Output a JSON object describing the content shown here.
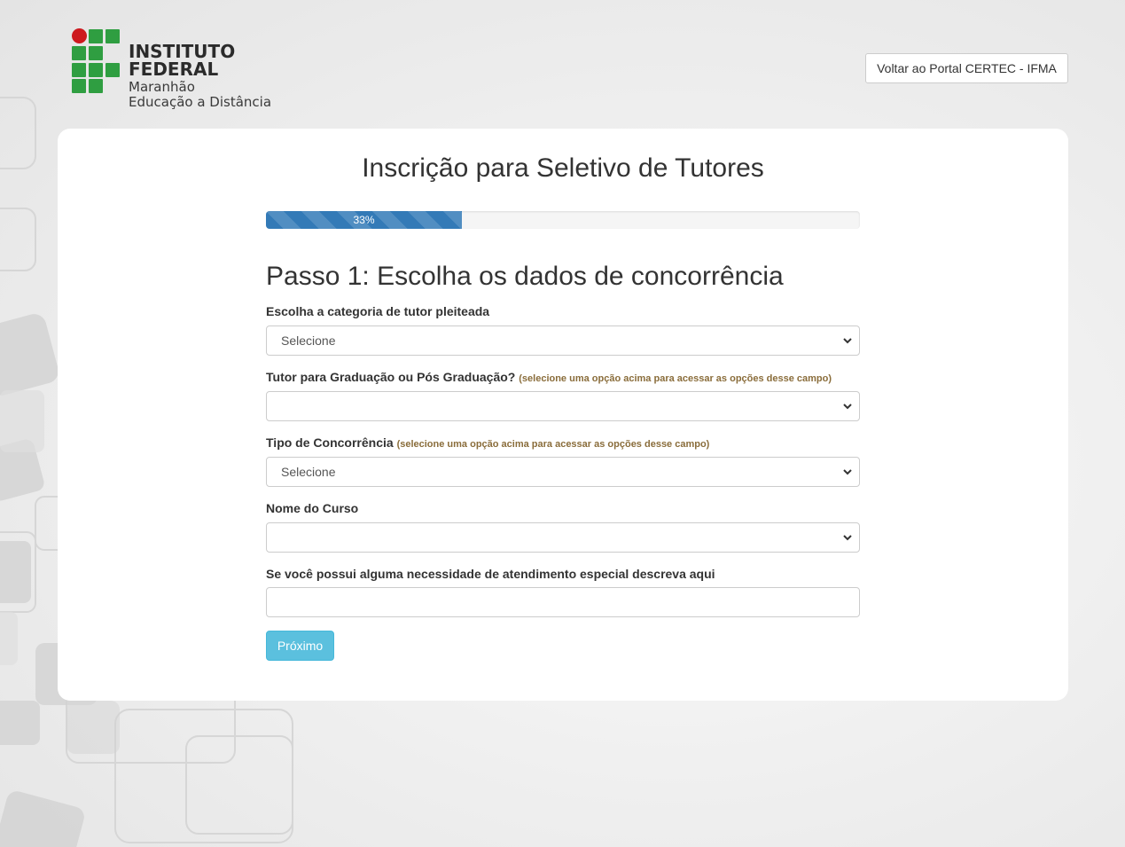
{
  "header": {
    "logo": {
      "title": "INSTITUTO FEDERAL",
      "line1": "Maranhão",
      "line2": "Educação a Distância",
      "colors": {
        "green": "#2f9e41",
        "red": "#cd191e"
      }
    },
    "portal_button_label": "Voltar ao Portal CERTEC - IFMA"
  },
  "main": {
    "title": "Inscrição para Seletivo de Tutores",
    "progress": {
      "value": 33,
      "label": "33%"
    },
    "step_title": "Passo 1: Escolha os dados de concorrência",
    "fields": {
      "categoria": {
        "label": "Escolha a categoria de tutor pleiteada",
        "value": "Selecione"
      },
      "graduacao": {
        "label": "Tutor para Graduação ou Pós Graduação?",
        "hint": "(selecione uma opção acima para acessar as opções desse campo)",
        "value": ""
      },
      "concorrencia": {
        "label": "Tipo de Concorrência",
        "hint": "(selecione uma opção acima para acessar as opções desse campo)",
        "value": "Selecione"
      },
      "curso": {
        "label": "Nome do Curso",
        "value": ""
      },
      "atendimento": {
        "label": "Se você possui alguma necessidade de atendimento especial descreva aqui",
        "value": ""
      }
    },
    "next_button_label": "Próximo"
  },
  "colors": {
    "progress_bar": "#337ab7",
    "next_button": "#5bc0de",
    "hint_text": "#8a6d3b"
  }
}
